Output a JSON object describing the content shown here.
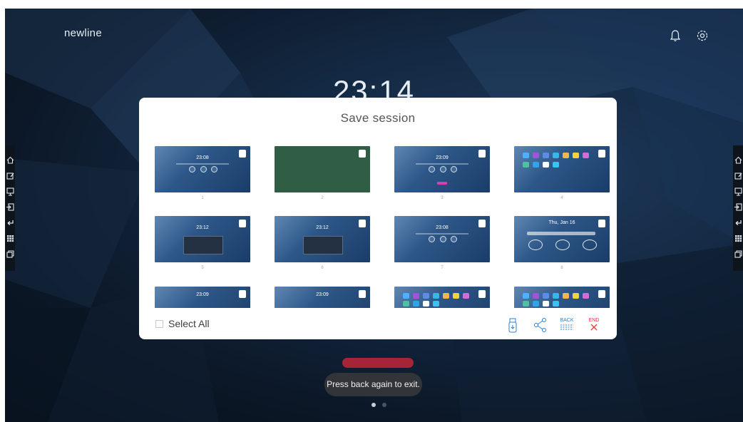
{
  "brand": "newline",
  "clock": "23:14",
  "top_icons": {
    "notifications": "bell-icon",
    "settings": "gear-icon"
  },
  "sidebar_left": {
    "items": [
      "home-icon",
      "edit-icon",
      "presentation-icon",
      "input-icon",
      "back-arrow-icon",
      "apps-grid-icon",
      "window-icon"
    ]
  },
  "sidebar_right": {
    "items": [
      "home-icon",
      "edit-icon",
      "presentation-icon",
      "input-icon",
      "back-arrow-icon",
      "apps-grid-icon",
      "window-icon"
    ]
  },
  "modal": {
    "title": "Save session",
    "select_all_label": "Select All",
    "thumbnails": [
      {
        "number": "1",
        "time": "23:08",
        "style": "home"
      },
      {
        "number": "2",
        "time": "",
        "style": "whiteboard"
      },
      {
        "number": "3",
        "time": "23:09",
        "style": "home"
      },
      {
        "number": "4",
        "time": "",
        "style": "apps"
      },
      {
        "number": "5",
        "time": "23:12",
        "style": "panel"
      },
      {
        "number": "6",
        "time": "23:12",
        "style": "panel"
      },
      {
        "number": "7",
        "time": "23:08",
        "style": "home"
      },
      {
        "number": "8",
        "time": "Thu, Jan 16",
        "style": "big"
      },
      {
        "number": "",
        "time": "23:09",
        "style": "home"
      },
      {
        "number": "",
        "time": "23:09",
        "style": "home"
      },
      {
        "number": "",
        "time": "",
        "style": "apps"
      },
      {
        "number": "",
        "time": "",
        "style": "apps"
      }
    ],
    "actions": {
      "save_icon": "usb-drive-icon",
      "share_icon": "share-icon",
      "back_label": "BACK",
      "end_label": "END"
    }
  },
  "toast": "Press back again to exit.",
  "pager": {
    "count": 2,
    "active": 0
  },
  "colors": {
    "accent_blue": "#2a7fd4",
    "end_red": "#e23b3b",
    "toast_bg": "#313438",
    "pill": "#a52437"
  }
}
